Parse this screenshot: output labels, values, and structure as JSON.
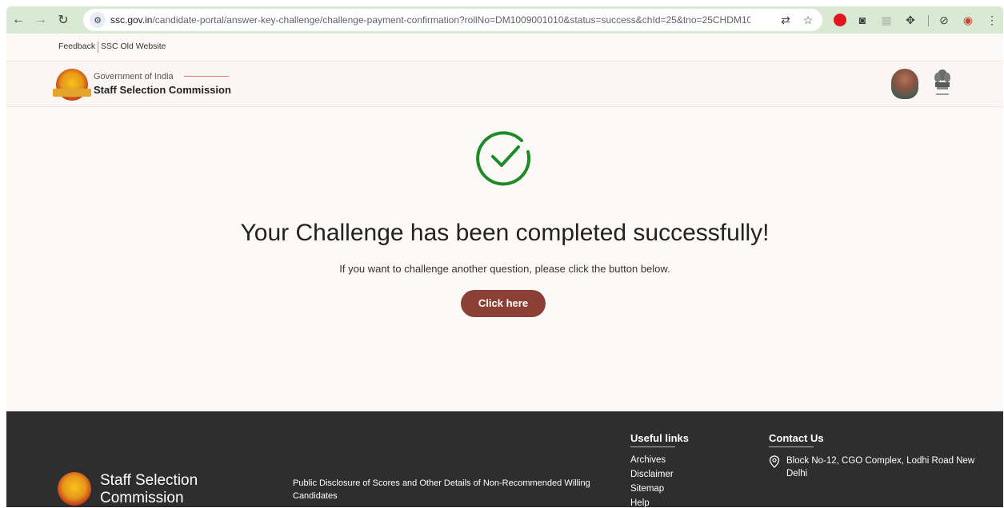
{
  "browser": {
    "url_host": "ssc.gov.in",
    "url_path": "/candidate-portal/answer-key-challenge/challenge-payment-confirmation?rollNo=DM1009001010&status=success&chId=25&tno=25CHDM1009001010..."
  },
  "topbar": {
    "links": [
      "Feedback",
      "SSC Old Website"
    ]
  },
  "header": {
    "gov_label": "Government of India",
    "org_name": "Staff Selection Commission"
  },
  "main": {
    "headline": "Your Challenge has been completed successfully!",
    "subtext": "If you want to challenge another question, please click the button below.",
    "button_label": "Click here",
    "success_color": "#1e8b2b",
    "button_color": "#8c3f34"
  },
  "footer": {
    "org_name": "Staff Selection Commission",
    "disclosure": "Public Disclosure of Scores and Other Details of Non-Recommended Willing Candidates",
    "useful_links_title": "Useful links",
    "useful_links": [
      "Archives",
      "Disclaimer",
      "Sitemap",
      "Help"
    ],
    "contact_title": "Contact Us",
    "address": "Block No-12, CGO Complex, Lodhi Road New Delhi"
  }
}
